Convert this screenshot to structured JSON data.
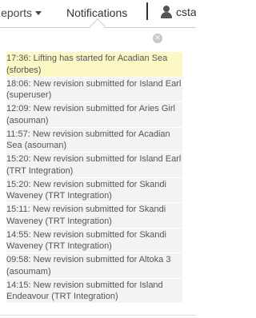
{
  "navbar": {
    "reports_label": "Reports",
    "notifications_label": "Notifications",
    "user_label": "csta"
  },
  "dropdown": {
    "close_glyph": "×",
    "notifications": [
      {
        "time": "17:36:",
        "message": "Lifting has started for Acadian Sea (sforbes)",
        "highlighted": true
      },
      {
        "time": "18:06:",
        "message": "New revision submitted for Island Earl (superuser)",
        "highlighted": false
      },
      {
        "time": "12:09:",
        "message": "New revision submitted for Aries Girl (asouman)",
        "highlighted": false
      },
      {
        "time": "11:57:",
        "message": "New revision submitted for Acadian Sea (asouman)",
        "highlighted": false
      },
      {
        "time": "15:20:",
        "message": "New revision submitted for Island Earl (TRT Integration)",
        "highlighted": false
      },
      {
        "time": "15:20:",
        "message": "New revision submitted for Skandi Waveney (TRT Integration)",
        "highlighted": false
      },
      {
        "time": "15:11:",
        "message": "New revision submitted for Skandi Waveney (TRT Integration)",
        "highlighted": false
      },
      {
        "time": "14:55:",
        "message": "New revision submitted for Skandi Waveney (TRT Integration)",
        "highlighted": false
      },
      {
        "time": "09:58:",
        "message": "New revision submitted for Altoka 3 (asoumam)",
        "highlighted": false
      },
      {
        "time": "14:15:",
        "message": "New revision submitted for Island Endeavour (TRT Integration)",
        "highlighted": false
      }
    ]
  },
  "colors": {
    "highlight": "#fcf8c6",
    "item_background": "#f3f3f3",
    "text": "#555555"
  },
  "icons": {
    "user": "user-icon",
    "caret": "caret-down-icon",
    "close": "close-icon"
  }
}
